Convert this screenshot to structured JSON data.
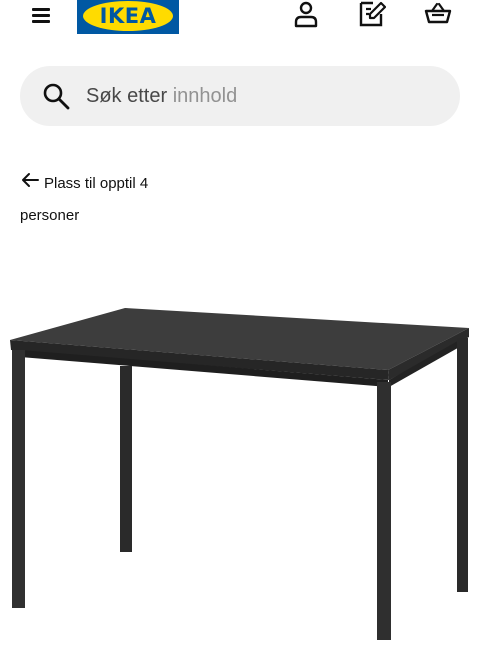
{
  "header": {
    "menu_icon": "hamburger-menu-icon",
    "logo_text": "IKEA",
    "logo_colors": {
      "blue": "#0058a3",
      "yellow": "#ffdb00"
    },
    "icons": [
      "person-icon",
      "notepad-pencil-icon",
      "shopping-basket-icon"
    ]
  },
  "search": {
    "placeholder_part1": "Søk etter",
    "placeholder_part2": "innhold",
    "icon": "search-icon"
  },
  "back_link": {
    "icon": "arrow-left-icon",
    "label": "Plass til opptil 4 personer"
  },
  "product": {
    "image": "black-dining-table",
    "color": "#3a3a3a"
  }
}
